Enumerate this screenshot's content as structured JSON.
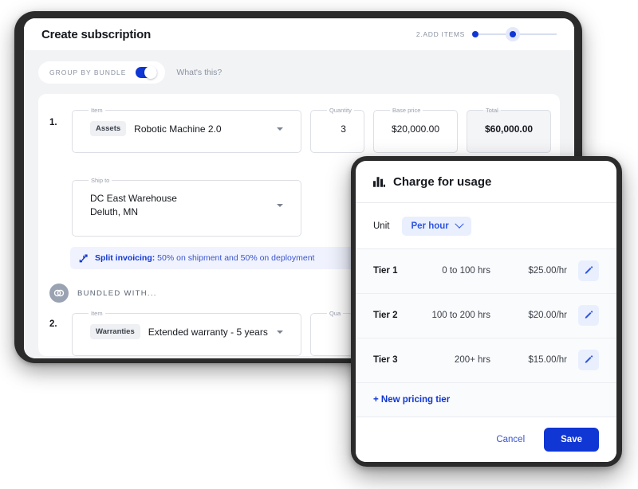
{
  "window": {
    "title": "Create subscription",
    "stepper": {
      "label": "2.ADD ITEMS"
    }
  },
  "toolbar": {
    "group_by_bundle_label": "GROUP BY BUNDLE",
    "whats_this": "What's this?",
    "toggle_on": true
  },
  "items": [
    {
      "number": "1.",
      "item_legend": "Item",
      "category_chip": "Assets",
      "name": "Robotic Machine 2.0",
      "quantity_legend": "Quantity",
      "quantity": "3",
      "base_price_legend": "Base price",
      "base_price": "$20,000.00",
      "total_legend": "Total",
      "total": "$60,000.00",
      "charge_for_usage": "Charge for usage",
      "ship_to_legend": "Ship to",
      "ship_to_line1": "DC East Warehouse",
      "ship_to_line2": "Deluth, MN",
      "banner_bold": "Split invoicing:",
      "banner_rest": " 50% on shipment and 50% on deployment"
    },
    {
      "number": "2.",
      "item_legend": "Item",
      "category_chip": "Warranties",
      "name": "Extended warranty - 5 years",
      "quantity_legend": "Qua"
    }
  ],
  "bundled": {
    "label": "BUNDLED WITH..."
  },
  "panel": {
    "title": "Charge for usage",
    "unit_label": "Unit",
    "unit_value": "Per hour",
    "tiers": [
      {
        "name": "Tier 1",
        "range": "0 to 100 hrs",
        "price": "$25.00/hr"
      },
      {
        "name": "Tier 2",
        "range": "100 to 200 hrs",
        "price": "$20.00/hr"
      },
      {
        "name": "Tier 3",
        "range": "200+ hrs",
        "price": "$15.00/hr"
      }
    ],
    "new_tier": "+ New pricing tier",
    "cancel": "Cancel",
    "save": "Save"
  },
  "colors": {
    "accent": "#1036d4",
    "accent_soft": "#e9effd",
    "body_bg": "#f2f3f5",
    "bezel": "#2b2b2b"
  }
}
